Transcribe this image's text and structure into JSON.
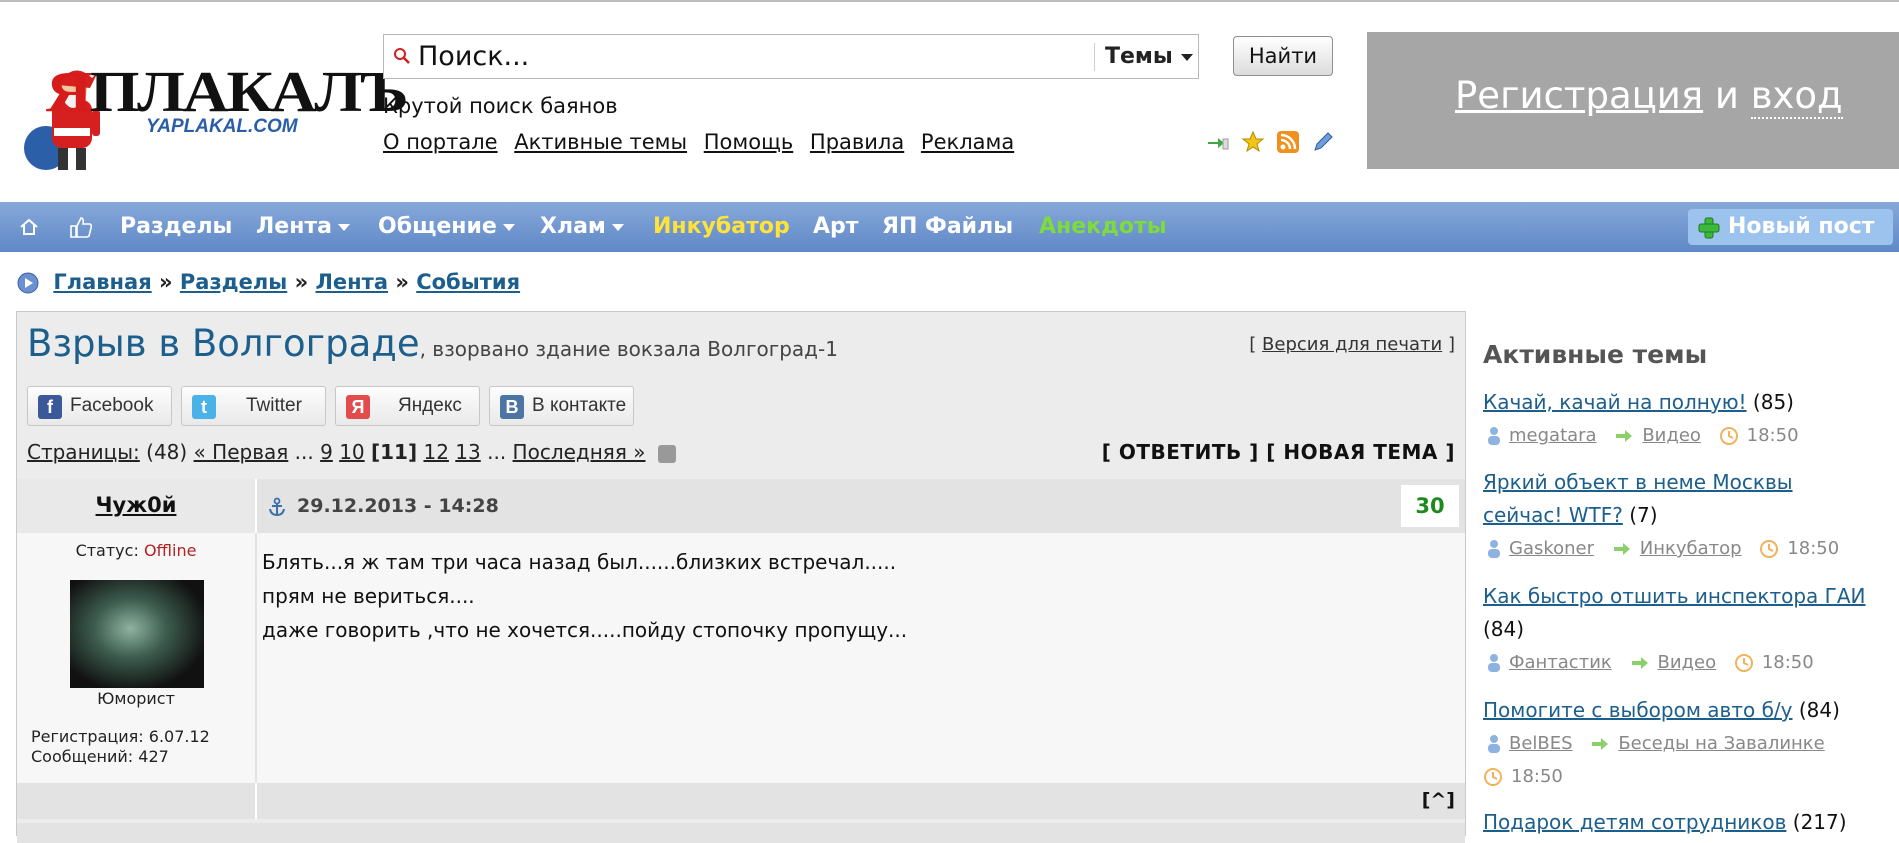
{
  "header": {
    "logo_text": "ЯПЛАКАЛЪ",
    "logo_subtext": "YAPLAKAL.COM",
    "search": {
      "placeholder": "Поиск...",
      "scope": "Темы",
      "button": "Найти",
      "hint": "Крутой поиск баянов"
    },
    "portal_links": [
      "О портале",
      "Активные темы",
      "Помощь",
      "Правила",
      "Реклама"
    ],
    "tool_icons": [
      "login-arrow-icon",
      "star-icon",
      "rss-icon",
      "pencil-icon"
    ],
    "auth": {
      "register": "Регистрация",
      "and": "и",
      "login": "вход"
    }
  },
  "nav": {
    "icons": [
      "home-icon",
      "thumbs-up-icon"
    ],
    "items": [
      {
        "label": "Разделы",
        "dropdown": false
      },
      {
        "label": "Лента",
        "dropdown": true
      },
      {
        "label": "Общение",
        "dropdown": true
      },
      {
        "label": "Хлам",
        "dropdown": true
      },
      {
        "label": "Инкубатор",
        "dropdown": false,
        "color": "#ffe33a"
      },
      {
        "label": "Арт",
        "dropdown": false
      },
      {
        "label": "ЯП Файлы",
        "dropdown": false
      },
      {
        "label": "Анекдоты",
        "dropdown": false,
        "color": "#7ddc3c"
      }
    ],
    "new_post": "Новый пост"
  },
  "breadcrumb": {
    "items": [
      "Главная",
      "Разделы",
      "Лента",
      "События"
    ],
    "separator": "»"
  },
  "topic": {
    "title": "Взрыв в Волгограде",
    "subtitle": ", взорвано здание вокзала Волгоград-1",
    "print": {
      "open": "[",
      "label": "Версия для печати",
      "close": "]"
    },
    "share": [
      {
        "label": "Facebook",
        "icon": "f",
        "color": "#3b5998"
      },
      {
        "label": "Twitter",
        "icon": "t",
        "color": "#4bb2e8"
      },
      {
        "label": "Яндекс",
        "icon": "Я",
        "color": "#e24c4c"
      },
      {
        "label": "В контакте",
        "icon": "B",
        "color": "#4c75a3"
      }
    ],
    "pages": {
      "label": "Страницы:",
      "count": "(48)",
      "first": "« Первая",
      "ellipsis": "...",
      "list": [
        "9",
        "10",
        "[11]",
        "12",
        "13"
      ],
      "last": "Последняя »"
    },
    "actions": {
      "reply": "[ ОТВЕТИТЬ ]",
      "new_topic": "[ НОВАЯ ТЕМА ]"
    }
  },
  "post": {
    "author": "Чуж0й",
    "date": "29.12.2013 - 14:28",
    "rating": "30",
    "status_label": "Статус:",
    "status_value": "Offline",
    "rank": "Юморист",
    "registration": "Регистрация: 6.07.12",
    "messages": "Сообщений: 427",
    "lines": [
      "Блять...я ж там три часа назад был......близких встречал.....",
      "прям не вериться....",
      "даже говорить ,что не хочется.....пойду стопочку пропущу..."
    ],
    "to_top": "[^]"
  },
  "sidebar": {
    "title": "Активные темы",
    "topics": [
      {
        "lines": [
          "Качай, качай на полную!"
        ],
        "count": "(85)",
        "user": "megatara",
        "section": "Видео",
        "time": "18:50"
      },
      {
        "lines": [
          "Яркий объект в неме Москвы",
          "сейчас! WTF?"
        ],
        "count": "(7)",
        "user": "Gaskoner",
        "section": "Инкубатор",
        "time": "18:50"
      },
      {
        "lines": [
          "Как быстро отшить инспектора ГАИ"
        ],
        "count": "(84)",
        "user": "Фантастик",
        "section": "Видео",
        "time": "18:50"
      },
      {
        "lines": [
          "Помогите с выбором авто б/у"
        ],
        "count": "(84)",
        "user": "BelBES",
        "section": "Беседы на Завалинке",
        "time": "18:50"
      },
      {
        "lines": [
          "Подарок детям сотрудников"
        ],
        "count": "(217)"
      }
    ]
  },
  "colors": {
    "nav_bg": "#6f95cf",
    "link": "#1c5e8c",
    "panel": "#a6a6a6",
    "offline": "#b22222",
    "rating": "#1d8a1d"
  }
}
